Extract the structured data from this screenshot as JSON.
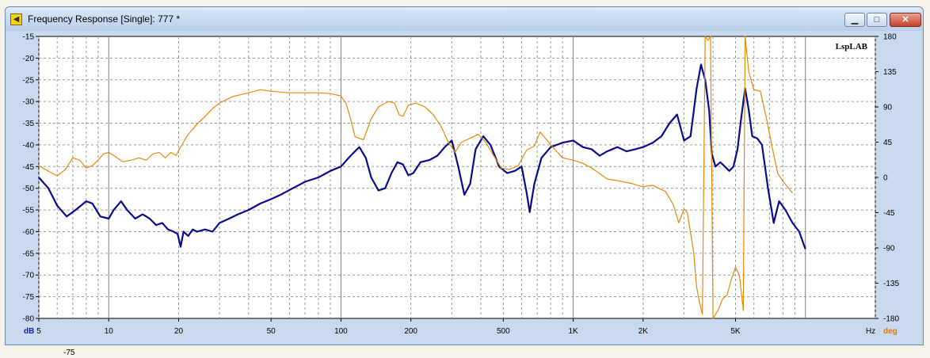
{
  "window": {
    "title": "Frequency Response [Single]: 777 *",
    "buttons": {
      "minimize": "▁",
      "maximize": "□",
      "close": "✕"
    }
  },
  "brand": "LspLAB",
  "background_text": "-75",
  "colors": {
    "magnitude": "#0a0a8c",
    "phase": "#e8890c",
    "unit_left": "#1a1aa0",
    "unit_right": "#e07a00"
  },
  "chart_data": {
    "type": "line",
    "x_scale": "log",
    "xlim": [
      5,
      20000
    ],
    "ylim_left": [
      -80,
      -15
    ],
    "ylim_right": [
      -180,
      180
    ],
    "grid": true,
    "xunit": "Hz",
    "yunit_left": "dB",
    "yunit_right": "deg",
    "x_tick_labels": [
      {
        "v": 5,
        "t": "5"
      },
      {
        "v": 10,
        "t": "10"
      },
      {
        "v": 20,
        "t": "20"
      },
      {
        "v": 50,
        "t": "50"
      },
      {
        "v": 100,
        "t": "100"
      },
      {
        "v": 200,
        "t": "200"
      },
      {
        "v": 500,
        "t": "500"
      },
      {
        "v": 1000,
        "t": "1K"
      },
      {
        "v": 2000,
        "t": "2K"
      },
      {
        "v": 5000,
        "t": "5K"
      }
    ],
    "y_left_ticks": [
      -15,
      -20,
      -25,
      -30,
      -35,
      -40,
      -45,
      -50,
      -55,
      -60,
      -65,
      -70,
      -75,
      -80
    ],
    "y_right_ticks": [
      180,
      135,
      90,
      45,
      0,
      -45,
      -90,
      -135,
      -180
    ],
    "series": [
      {
        "axis": "left",
        "points": [
          [
            5,
            -47.5
          ],
          [
            5.5,
            -50
          ],
          [
            6,
            -54
          ],
          [
            6.6,
            -56.5
          ],
          [
            7.2,
            -55
          ],
          [
            8,
            -53
          ],
          [
            8.5,
            -53.5
          ],
          [
            9.2,
            -56.5
          ],
          [
            10,
            -57
          ],
          [
            10.5,
            -55
          ],
          [
            11.3,
            -53
          ],
          [
            12,
            -55
          ],
          [
            13,
            -57
          ],
          [
            14,
            -56
          ],
          [
            15,
            -57
          ],
          [
            16,
            -58.5
          ],
          [
            17,
            -58
          ],
          [
            18,
            -59.5
          ],
          [
            19,
            -60
          ],
          [
            19.8,
            -60.5
          ],
          [
            20.4,
            -63.5
          ],
          [
            21,
            -60
          ],
          [
            22,
            -61
          ],
          [
            23,
            -59.5
          ],
          [
            24,
            -60
          ],
          [
            26,
            -59.5
          ],
          [
            28,
            -60
          ],
          [
            30,
            -58
          ],
          [
            33,
            -57
          ],
          [
            36,
            -56
          ],
          [
            40,
            -55
          ],
          [
            45,
            -53.5
          ],
          [
            50,
            -52.5
          ],
          [
            55,
            -51.5
          ],
          [
            62,
            -50
          ],
          [
            70,
            -48.5
          ],
          [
            80,
            -47.5
          ],
          [
            90,
            -46
          ],
          [
            100,
            -45
          ],
          [
            110,
            -42.5
          ],
          [
            120,
            -40.5
          ],
          [
            128,
            -43
          ],
          [
            135,
            -47.5
          ],
          [
            145,
            -50.5
          ],
          [
            155,
            -50
          ],
          [
            165,
            -46.5
          ],
          [
            175,
            -44
          ],
          [
            185,
            -44.5
          ],
          [
            195,
            -47
          ],
          [
            205,
            -46.5
          ],
          [
            220,
            -44
          ],
          [
            240,
            -43.5
          ],
          [
            260,
            -42.5
          ],
          [
            280,
            -40.5
          ],
          [
            300,
            -39
          ],
          [
            320,
            -45
          ],
          [
            340,
            -51.5
          ],
          [
            360,
            -49
          ],
          [
            380,
            -41
          ],
          [
            410,
            -38
          ],
          [
            440,
            -40
          ],
          [
            480,
            -45
          ],
          [
            520,
            -46.5
          ],
          [
            560,
            -46
          ],
          [
            600,
            -45
          ],
          [
            630,
            -51
          ],
          [
            650,
            -55.5
          ],
          [
            680,
            -49
          ],
          [
            730,
            -43
          ],
          [
            800,
            -40.5
          ],
          [
            900,
            -39.5
          ],
          [
            1000,
            -39
          ],
          [
            1100,
            -40.5
          ],
          [
            1200,
            -41
          ],
          [
            1300,
            -42.5
          ],
          [
            1400,
            -41.5
          ],
          [
            1550,
            -40.5
          ],
          [
            1700,
            -41.5
          ],
          [
            1850,
            -41
          ],
          [
            2000,
            -40.5
          ],
          [
            2200,
            -39.5
          ],
          [
            2400,
            -38
          ],
          [
            2600,
            -35
          ],
          [
            2800,
            -33
          ],
          [
            3000,
            -39
          ],
          [
            3200,
            -38
          ],
          [
            3400,
            -27
          ],
          [
            3550,
            -21.5
          ],
          [
            3700,
            -25
          ],
          [
            3850,
            -32
          ],
          [
            3950,
            -42
          ],
          [
            4100,
            -45
          ],
          [
            4300,
            -44
          ],
          [
            4500,
            -45
          ],
          [
            4700,
            -46
          ],
          [
            4900,
            -45
          ],
          [
            5100,
            -41
          ],
          [
            5300,
            -33.5
          ],
          [
            5500,
            -27
          ],
          [
            5700,
            -32
          ],
          [
            5900,
            -38
          ],
          [
            6200,
            -38.5
          ],
          [
            6500,
            -40
          ],
          [
            6900,
            -50
          ],
          [
            7300,
            -58
          ],
          [
            7700,
            -53
          ],
          [
            8200,
            -55
          ],
          [
            8800,
            -58
          ],
          [
            9400,
            -60
          ],
          [
            10000,
            -64
          ]
        ]
      },
      {
        "axis": "right",
        "points": [
          [
            5,
            15
          ],
          [
            5.5,
            8
          ],
          [
            6,
            2
          ],
          [
            6.5,
            10
          ],
          [
            7,
            25
          ],
          [
            7.5,
            22
          ],
          [
            8,
            12
          ],
          [
            8.5,
            15
          ],
          [
            9,
            22
          ],
          [
            9.5,
            30
          ],
          [
            10,
            32
          ],
          [
            10.5,
            28
          ],
          [
            11.5,
            20
          ],
          [
            12.5,
            22
          ],
          [
            13.5,
            25
          ],
          [
            14.5,
            22
          ],
          [
            15.5,
            30
          ],
          [
            16.5,
            32
          ],
          [
            17.5,
            25
          ],
          [
            18.5,
            32
          ],
          [
            19.5,
            28
          ],
          [
            20.5,
            40
          ],
          [
            22,
            55
          ],
          [
            24,
            68
          ],
          [
            26,
            78
          ],
          [
            28,
            88
          ],
          [
            30,
            95
          ],
          [
            34,
            103
          ],
          [
            40,
            108
          ],
          [
            45,
            112
          ],
          [
            50,
            110
          ],
          [
            60,
            108
          ],
          [
            70,
            108
          ],
          [
            80,
            108
          ],
          [
            90,
            107
          ],
          [
            100,
            104
          ],
          [
            105,
            95
          ],
          [
            110,
            75
          ],
          [
            115,
            52
          ],
          [
            125,
            48
          ],
          [
            135,
            75
          ],
          [
            145,
            90
          ],
          [
            160,
            97
          ],
          [
            170,
            95
          ],
          [
            178,
            80
          ],
          [
            185,
            78
          ],
          [
            195,
            92
          ],
          [
            210,
            95
          ],
          [
            230,
            90
          ],
          [
            250,
            80
          ],
          [
            270,
            65
          ],
          [
            290,
            45
          ],
          [
            310,
            32
          ],
          [
            330,
            45
          ],
          [
            360,
            50
          ],
          [
            390,
            55
          ],
          [
            420,
            45
          ],
          [
            450,
            30
          ],
          [
            490,
            12
          ],
          [
            530,
            10
          ],
          [
            580,
            15
          ],
          [
            630,
            35
          ],
          [
            680,
            40
          ],
          [
            720,
            58
          ],
          [
            760,
            50
          ],
          [
            820,
            38
          ],
          [
            900,
            25
          ],
          [
            1000,
            22
          ],
          [
            1100,
            18
          ],
          [
            1200,
            12
          ],
          [
            1300,
            5
          ],
          [
            1400,
            -2
          ],
          [
            1600,
            -5
          ],
          [
            1800,
            -8
          ],
          [
            2000,
            -12
          ],
          [
            2200,
            -10
          ],
          [
            2500,
            -18
          ],
          [
            2700,
            -35
          ],
          [
            2850,
            -58
          ],
          [
            3000,
            -40
          ],
          [
            3100,
            -45
          ],
          [
            3300,
            -95
          ],
          [
            3400,
            -140
          ],
          [
            3500,
            -160
          ],
          [
            3600,
            -175
          ],
          [
            3700,
            180
          ],
          [
            3800,
            175
          ],
          [
            3900,
            180
          ],
          [
            4000,
            -180
          ],
          [
            4200,
            -170
          ],
          [
            4400,
            -155
          ],
          [
            4600,
            -150
          ],
          [
            4800,
            -130
          ],
          [
            5000,
            -115
          ],
          [
            5200,
            -125
          ],
          [
            5400,
            -170
          ],
          [
            5500,
            180
          ],
          [
            5700,
            135
          ],
          [
            6000,
            112
          ],
          [
            6400,
            110
          ],
          [
            6800,
            75
          ],
          [
            7200,
            38
          ],
          [
            7600,
            5
          ],
          [
            8000,
            -5
          ],
          [
            8800,
            -20
          ]
        ]
      }
    ]
  }
}
